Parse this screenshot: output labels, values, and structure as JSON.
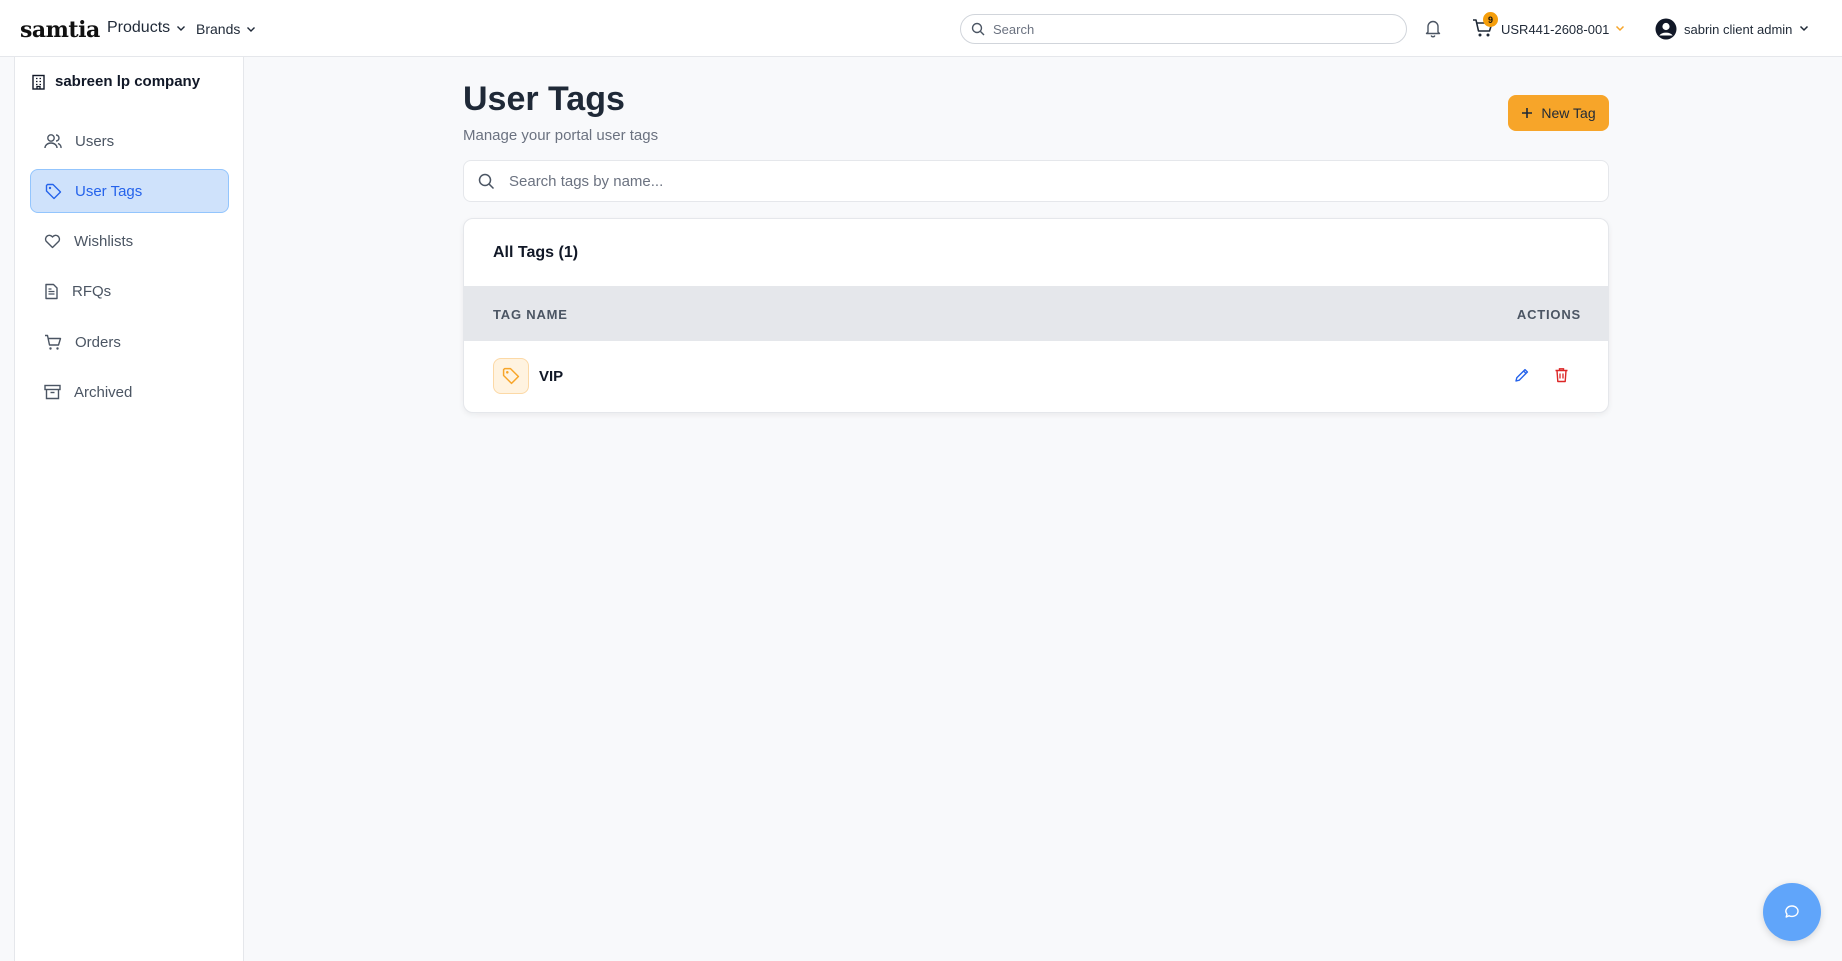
{
  "header": {
    "logo_text": "samtia",
    "nav": {
      "products_label": "Products",
      "brands_label": "Brands"
    },
    "search": {
      "placeholder": "Search"
    },
    "cart": {
      "badge_count": "9"
    },
    "account_code": "USR441-2608-001",
    "user_name": "sabrin client admin"
  },
  "sidebar": {
    "company": "sabreen lp company",
    "items": [
      {
        "label": "Users",
        "icon": "users-icon",
        "active": false
      },
      {
        "label": "User Tags",
        "icon": "tag-icon",
        "active": true
      },
      {
        "label": "Wishlists",
        "icon": "heart-icon",
        "active": false
      },
      {
        "label": "RFQs",
        "icon": "document-icon",
        "active": false
      },
      {
        "label": "Orders",
        "icon": "cart-icon",
        "active": false
      },
      {
        "label": "Archived",
        "icon": "archive-icon",
        "active": false
      }
    ]
  },
  "main": {
    "title": "User Tags",
    "subtitle": "Manage your portal user tags",
    "new_tag_label": "New Tag",
    "search_placeholder": "Search tags by name...",
    "card_title": "All Tags (1)",
    "table": {
      "columns": [
        "TAG NAME",
        "ACTIONS"
      ],
      "rows": [
        {
          "name": "VIP"
        }
      ]
    }
  },
  "colors": {
    "accent": "#f7a529",
    "primary": "#2563eb",
    "danger": "#dc2626",
    "active_bg": "#cfe2fb"
  }
}
